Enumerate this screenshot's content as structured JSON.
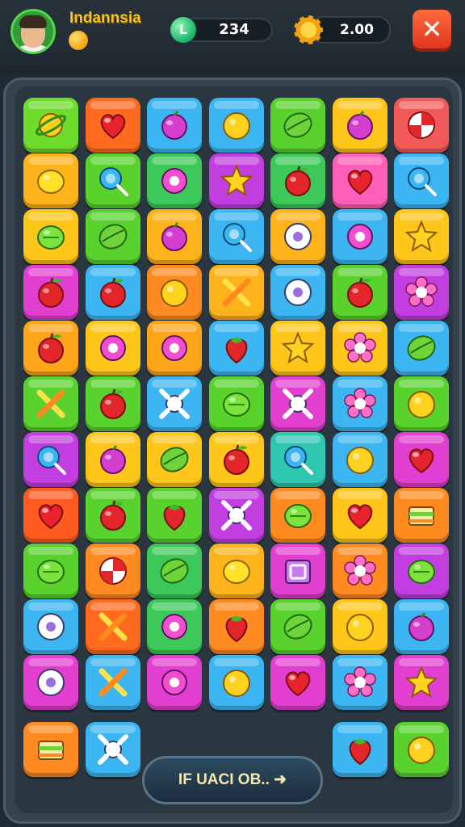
{
  "header": {
    "player_name": "Indannsia",
    "score_value": "234",
    "score_badge_glyph": "L",
    "coins_value": "2.00",
    "close_glyph": "✕"
  },
  "board": {
    "columns": 7,
    "rows": [
      [
        {
          "color": "#6fdc2c",
          "icon": "planet-fruit-icon"
        },
        {
          "color": "#ff6a1f",
          "icon": "heart-icon"
        },
        {
          "color": "#3bb6f2",
          "icon": "plum-icon"
        },
        {
          "color": "#3bb6f2",
          "icon": "orange-icon"
        },
        {
          "color": "#59d22d",
          "icon": "melon-icon"
        },
        {
          "color": "#ffc61a",
          "icon": "plum-icon"
        },
        {
          "color": "#f25a5a",
          "icon": "peppermint-candy-icon"
        }
      ],
      [
        {
          "color": "#ffb31a",
          "icon": "lemon-icon"
        },
        {
          "color": "#59d22d",
          "icon": "lollipop-icon"
        },
        {
          "color": "#3cc95a",
          "icon": "ring-candy-icon"
        },
        {
          "color": "#c23ee0",
          "icon": "star-candy-icon"
        },
        {
          "color": "#3cc95a",
          "icon": "apple-icon"
        },
        {
          "color": "#ff5fb8",
          "icon": "heart-icon"
        },
        {
          "color": "#3bb6f2",
          "icon": "lollipop-icon"
        }
      ],
      [
        {
          "color": "#ffc61a",
          "icon": "lime-icon"
        },
        {
          "color": "#59d22d",
          "icon": "melon-icon"
        },
        {
          "color": "#ffb31a",
          "icon": "plum-icon"
        },
        {
          "color": "#3bb6f2",
          "icon": "lollipop-icon"
        },
        {
          "color": "#ffb31a",
          "icon": "donut-icon"
        },
        {
          "color": "#3bb6f2",
          "icon": "ring-candy-icon"
        },
        {
          "color": "#ffc61a",
          "icon": "star-candy-icon"
        }
      ],
      [
        {
          "color": "#e23ed0",
          "icon": "apple-icon"
        },
        {
          "color": "#3bb6f2",
          "icon": "apple-icon"
        },
        {
          "color": "#ff8a1f",
          "icon": "orange-icon"
        },
        {
          "color": "#ffb31a",
          "icon": "crossed-sticks-icon"
        },
        {
          "color": "#3bb6f2",
          "icon": "donut-icon"
        },
        {
          "color": "#59d22d",
          "icon": "apple-icon"
        },
        {
          "color": "#c23ee0",
          "icon": "flower-candy-icon"
        }
      ],
      [
        {
          "color": "#ffa51a",
          "icon": "apple-icon"
        },
        {
          "color": "#ffc61a",
          "icon": "ring-candy-icon"
        },
        {
          "color": "#ffa51a",
          "icon": "ring-candy-icon"
        },
        {
          "color": "#3bb6f2",
          "icon": "strawberry-icon"
        },
        {
          "color": "#ffc61a",
          "icon": "star-candy-icon"
        },
        {
          "color": "#ffc61a",
          "icon": "flower-candy-icon"
        },
        {
          "color": "#3bb6f2",
          "icon": "melon-icon"
        }
      ],
      [
        {
          "color": "#59d22d",
          "icon": "crossed-sticks-icon"
        },
        {
          "color": "#59d22d",
          "icon": "apple-icon"
        },
        {
          "color": "#3bb6f2",
          "icon": "wrapped-candy-icon"
        },
        {
          "color": "#59d22d",
          "icon": "lime-icon"
        },
        {
          "color": "#e23ed0",
          "icon": "wrapped-candy-icon"
        },
        {
          "color": "#3bb6f2",
          "icon": "flower-candy-icon"
        },
        {
          "color": "#59d22d",
          "icon": "orange-icon"
        }
      ],
      [
        {
          "color": "#c23ee0",
          "icon": "lollipop-icon"
        },
        {
          "color": "#ffc61a",
          "icon": "plum-icon"
        },
        {
          "color": "#ffc61a",
          "icon": "melon-icon"
        },
        {
          "color": "#ffc61a",
          "icon": "apple-icon"
        },
        {
          "color": "#2fc7b0",
          "icon": "lollipop-icon"
        },
        {
          "color": "#3bb6f2",
          "icon": "orange-icon"
        },
        {
          "color": "#e23ed0",
          "icon": "heart-icon"
        }
      ],
      [
        {
          "color": "#ff5a1f",
          "icon": "heart-icon"
        },
        {
          "color": "#59d22d",
          "icon": "apple-icon"
        },
        {
          "color": "#59d22d",
          "icon": "strawberry-icon"
        },
        {
          "color": "#c23ee0",
          "icon": "wrapped-candy-icon"
        },
        {
          "color": "#ff8a1f",
          "icon": "lime-icon"
        },
        {
          "color": "#ffc61a",
          "icon": "heart-icon"
        },
        {
          "color": "#ff8a1f",
          "icon": "cake-icon"
        }
      ],
      [
        {
          "color": "#59d22d",
          "icon": "lime-icon"
        },
        {
          "color": "#ff8a1f",
          "icon": "peppermint-candy-icon"
        },
        {
          "color": "#3cc95a",
          "icon": "melon-icon"
        },
        {
          "color": "#ffb31a",
          "icon": "lemon-icon"
        },
        {
          "color": "#e23ed0",
          "icon": "gift-box-icon"
        },
        {
          "color": "#ff8a1f",
          "icon": "flower-candy-icon"
        },
        {
          "color": "#c23ee0",
          "icon": "lime-icon"
        }
      ],
      [
        {
          "color": "#3bb6f2",
          "icon": "donut-icon"
        },
        {
          "color": "#ff6a1f",
          "icon": "crossed-sticks-icon"
        },
        {
          "color": "#3cc95a",
          "icon": "ring-candy-icon"
        },
        {
          "color": "#ff8a1f",
          "icon": "strawberry-icon"
        },
        {
          "color": "#59d22d",
          "icon": "melon-icon"
        },
        {
          "color": "#ffc61a",
          "icon": "orange-icon"
        },
        {
          "color": "#3bb6f2",
          "icon": "plum-icon"
        }
      ],
      [
        {
          "color": "#e23ed0",
          "icon": "donut-icon"
        },
        {
          "color": "#3bb6f2",
          "icon": "crossed-sticks-icon"
        },
        {
          "color": "#e23ed0",
          "icon": "ring-candy-icon"
        },
        {
          "color": "#3bb6f2",
          "icon": "orange-icon"
        },
        {
          "color": "#e23ed0",
          "icon": "heart-icon"
        },
        {
          "color": "#3bb6f2",
          "icon": "flower-candy-icon"
        },
        {
          "color": "#e23ed0",
          "icon": "star-candy-icon"
        }
      ]
    ],
    "bottom_left_tiles": [
      {
        "color": "#ff8a1f",
        "icon": "cake-icon"
      },
      {
        "color": "#3bb6f2",
        "icon": "wrapped-candy-icon"
      }
    ],
    "bottom_right_tiles": [
      {
        "color": "#3bb6f2",
        "icon": "strawberry-icon"
      },
      {
        "color": "#59d22d",
        "icon": "orange-icon"
      }
    ]
  },
  "bottom_button": {
    "label": "IF UACI OB.. ➜"
  }
}
